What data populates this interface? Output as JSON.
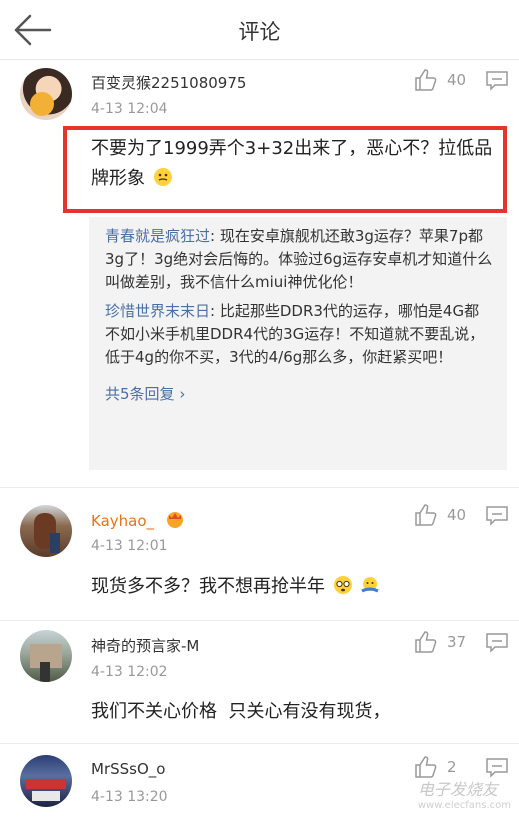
{
  "header": {
    "title": "评论"
  },
  "comments": [
    {
      "username": "百变灵猴2251080975",
      "time": "4-13 12:04",
      "likes": "40",
      "text": "不要为了1999弄个3+32出来了，恶心不？拉低品牌形象",
      "replies": [
        {
          "name": "青春就是疯狂过",
          "text": ": 现在安卓旗舰机还敢3g运存？苹果7p都3g了！3g绝对会后悔的。体验过6g运存安卓机才知道什么叫做差别，我不信什么miui神优化伦！"
        },
        {
          "name": "珍惜世界末末日",
          "text": ": 比起那些DDR3代的运存，哪怕是4G都不如小米手机里DDR4代的3G运存！不知道就不要乱说，低于4g的你不买，3代的4/6g那么多，你赶紧买吧！"
        }
      ],
      "more_replies": "共5条回复"
    },
    {
      "username": "Kayhao_",
      "time": "4-13 12:01",
      "likes": "40",
      "text": "现货多不多？我不想再抢半年"
    },
    {
      "username": "神奇的预言家-M",
      "time": "4-13 12:02",
      "likes": "37",
      "text": "我们不关心价格  只关心有没有现货，"
    },
    {
      "username": "MrSSsO_o",
      "time": "4-13 13:20",
      "likes": "2",
      "text": ""
    }
  ],
  "watermark": {
    "text": "电子发烧友",
    "sub": "www.elecfans.com"
  }
}
